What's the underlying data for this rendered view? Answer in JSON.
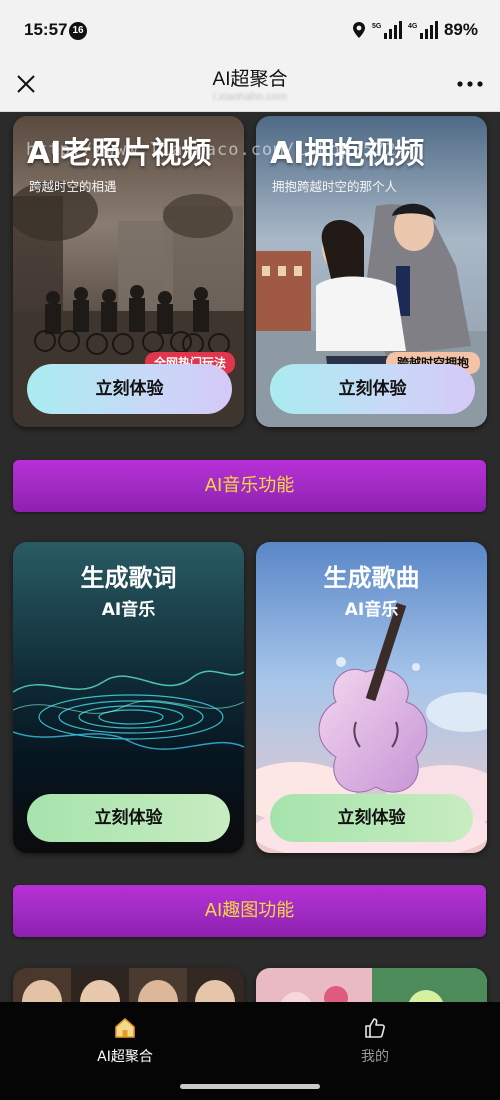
{
  "status_bar": {
    "time": "15:57",
    "notification_count": "16",
    "network_1": "5G",
    "network_2": "4G",
    "battery": "89%"
  },
  "nav": {
    "title": "AI超聚合",
    "subtitle": "i.xiaohaho.com"
  },
  "watermark": "http://www.lianmaco.com/ishop3572",
  "cards": {
    "old_photo": {
      "title": "AI老照片视频",
      "desc": "跨越时空的相遇",
      "tag": "全网热门玩法",
      "cta": "立刻体验"
    },
    "hug": {
      "title": "AI拥抱视频",
      "desc": "拥抱跨越时空的那个人",
      "tag": "跨越时空拥抱",
      "cta": "立刻体验"
    },
    "lyrics": {
      "title": "生成歌词",
      "subtitle": "AI音乐",
      "cta": "立刻体验"
    },
    "song": {
      "title": "生成歌曲",
      "subtitle": "AI音乐",
      "cta": "立刻体验"
    }
  },
  "sections": {
    "music": "AI音乐功能",
    "fun_image": "AI趣图功能"
  },
  "tabs": [
    {
      "label": "AI超聚合",
      "icon": "home-icon",
      "active": true
    },
    {
      "label": "我的",
      "icon": "thumbs-up-icon",
      "active": false
    }
  ],
  "colors": {
    "section_gradient_top": "#b82fd6",
    "section_text": "#f7d640",
    "tag_red": "#e0354c",
    "tag_peach": "#f4c3a6",
    "tab_active": "#ffffff",
    "tab_inactive": "#9a9a9a"
  }
}
